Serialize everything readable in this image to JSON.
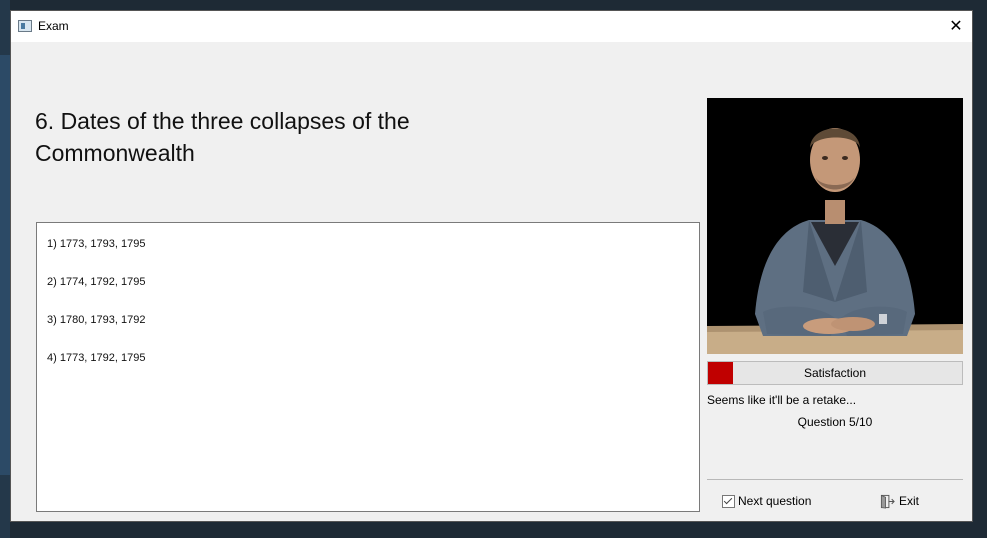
{
  "window": {
    "title": "Exam",
    "close_glyph": "✕"
  },
  "question": {
    "text": "6. Dates of the three collapses of the Commonwealth"
  },
  "answers": [
    "1) 1773, 1793, 1795",
    "2) 1774, 1792, 1795",
    "3) 1780, 1793, 1792",
    "4) 1773, 1792, 1795"
  ],
  "satisfaction": {
    "label": "Satisfaction",
    "level": 0.1,
    "color": "#c00000"
  },
  "status_text": "Seems like it'll be a retake...",
  "question_counter": "Question 5/10",
  "buttons": {
    "next": "Next question",
    "exit": "Exit"
  },
  "icons": {
    "app": "window-app-icon",
    "next": "checkbox-icon",
    "exit": "exit-door-icon"
  }
}
